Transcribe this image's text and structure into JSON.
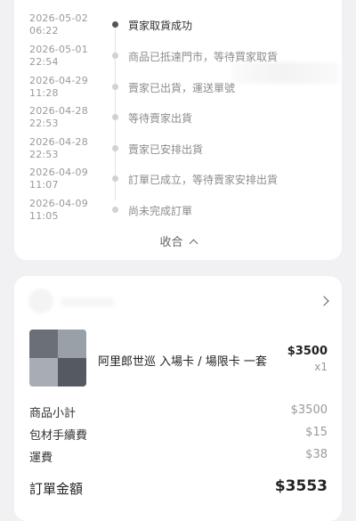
{
  "timeline": [
    {
      "time_date": "2026-05-02",
      "time_clock": "06:22",
      "status": "買家取貨成功",
      "active": true
    },
    {
      "time_date": "2026-05-01",
      "time_clock": "22:54",
      "status": "商品已抵達門市，等待買家取貨",
      "active": false
    },
    {
      "time_date": "2026-04-29",
      "time_clock": "11:28",
      "status": "賣家已出貨，運送單號",
      "active": false
    },
    {
      "time_date": "2026-04-28",
      "time_clock": "22:53",
      "status": "等待賣家出貨",
      "active": false
    },
    {
      "time_date": "2026-04-28",
      "time_clock": "22:53",
      "status": "賣家已安排出貨",
      "active": false
    },
    {
      "time_date": "2026-04-09",
      "time_clock": "11:07",
      "status": "訂單已成立，等待賣家安排出貨",
      "active": false
    },
    {
      "time_date": "2026-04-09",
      "time_clock": "11:05",
      "status": "尚未完成訂單",
      "active": false
    }
  ],
  "collapse_label": "收合",
  "order": {
    "product_name": "阿里郎世巡 入場卡 / 場限卡 一套",
    "price": "$3500",
    "quantity": "x1",
    "summary": [
      {
        "label": "商品小計",
        "value": "$3500"
      },
      {
        "label": "包材手續費",
        "value": "$15"
      },
      {
        "label": "運費",
        "value": "$38"
      }
    ],
    "total_label": "訂單金額",
    "total_value": "$3553"
  },
  "colors": {
    "active_dot": "#555555",
    "inactive_dot": "#d2d2d2",
    "page_bg": "#f1f1f3"
  }
}
